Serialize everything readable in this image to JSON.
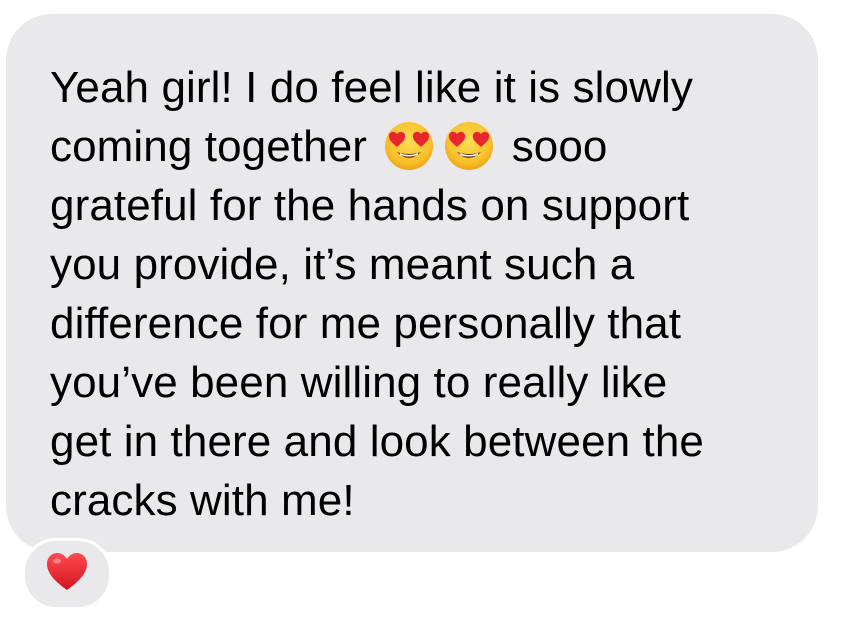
{
  "message": {
    "lines": [
      "Yeah girl! I do feel like it is slowly",
      "coming together",
      "sooo",
      "grateful for the hands on support",
      "you provide, it’s meant such a",
      "difference for me personally that",
      "you’ve been willing to really like",
      "get in there and look between the",
      "cracks with me!"
    ],
    "inline_emojis": [
      "heart-eyes-face",
      "heart-eyes-face"
    ]
  },
  "reaction": {
    "icon": "red-heart",
    "color": "#e8262f"
  },
  "colors": {
    "bubble": "#e9e9eb",
    "text": "#000000",
    "background": "#ffffff"
  }
}
